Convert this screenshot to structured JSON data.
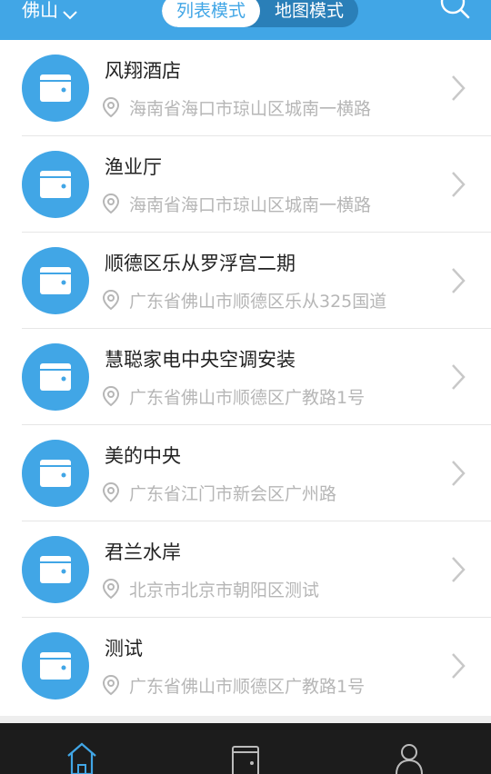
{
  "header": {
    "city": "佛山",
    "mode_list": "列表模式",
    "mode_map": "地图模式"
  },
  "colors": {
    "accent": "#41a6e6",
    "tabbar_bg": "#1c1c1c",
    "muted_text": "#b6b6b6"
  },
  "items": [
    {
      "title": "风翔酒店",
      "address": "海南省海口市琼山区城南一横路"
    },
    {
      "title": "渔业厅",
      "address": "海南省海口市琼山区城南一横路"
    },
    {
      "title": "顺德区乐从罗浮宫二期",
      "address": "广东省佛山市顺德区乐从325国道"
    },
    {
      "title": "慧聪家电中央空调安装",
      "address": "广东省佛山市顺德区广教路1号"
    },
    {
      "title": "美的中央",
      "address": "广东省江门市新会区广州路"
    },
    {
      "title": "君兰水岸",
      "address": "北京市北京市朝阳区测试"
    },
    {
      "title": "测试",
      "address": "广东省佛山市顺德区广教路1号"
    }
  ],
  "icons": {
    "item": "wallet-icon",
    "location": "location-pin-icon",
    "chevron": "chevron-right-icon",
    "search": "search-icon",
    "tabs": [
      "home-icon",
      "wallet-icon",
      "user-icon"
    ]
  }
}
